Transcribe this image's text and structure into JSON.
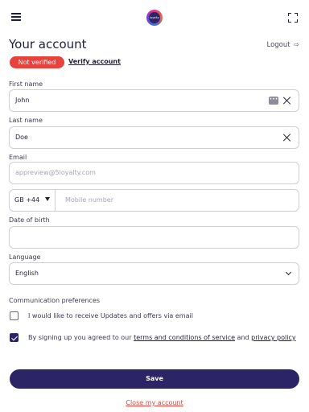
{
  "header": {
    "menu_icon": "hamburger-menu-icon",
    "logo_text": "loyalty",
    "fullscreen_icon": "fullscreen-icon"
  },
  "account": {
    "title": "Your account",
    "logout_label": "Logout",
    "logout_icon": "⇨",
    "status_badge": "Not verified",
    "verify_link": "Verify account"
  },
  "form": {
    "first_name": {
      "label": "First name",
      "value": "John"
    },
    "last_name": {
      "label": "Last name",
      "value": "Doe"
    },
    "email": {
      "label": "Email",
      "placeholder": "appreview@5loyalty.com"
    },
    "phone": {
      "country_code": "GB +44",
      "placeholder": "Mobile number"
    },
    "dob": {
      "label": "Date of birth",
      "value": ""
    },
    "language": {
      "label": "Language",
      "value": "English"
    }
  },
  "preferences": {
    "title": "Communication preferences",
    "marketing": {
      "label": "I would like to receive Updates and offers via email",
      "checked": false
    },
    "terms": {
      "prefix": "By signing up you agreed to our ",
      "terms_link": "terms and conditions of service",
      "middle": " and ",
      "privacy_link": "privacy policy",
      "checked": true
    }
  },
  "actions": {
    "save_label": "Save",
    "close_account_label": "Close my account"
  },
  "colors": {
    "primary": "#2b2566",
    "danger": "#e8423c"
  }
}
